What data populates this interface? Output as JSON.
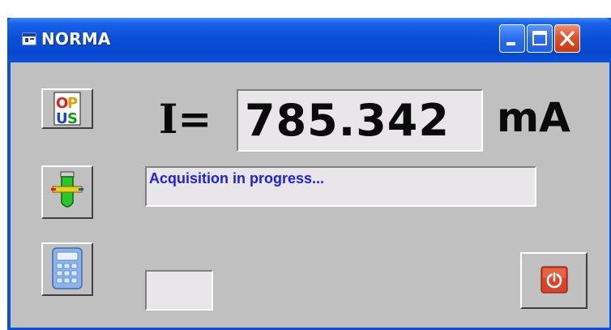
{
  "window": {
    "title": "NORMA",
    "controls": {
      "minimize": "minimize",
      "maximize": "maximize",
      "close": "close"
    }
  },
  "reading": {
    "label": "I=",
    "value": "785.342",
    "unit": "mA"
  },
  "status_text": "Acquisition in progress...",
  "small_field_value": "",
  "icons": {
    "opus": "opus-logo-icon",
    "probe": "test-tube-probe-icon",
    "calculator": "calculator-icon",
    "stop": "power-stop-icon"
  },
  "colors": {
    "titlebar": "#0a4fd6",
    "status_text": "#1e1ee6",
    "stop_button": "#d8442a",
    "form_background": "#c0c0c0"
  }
}
